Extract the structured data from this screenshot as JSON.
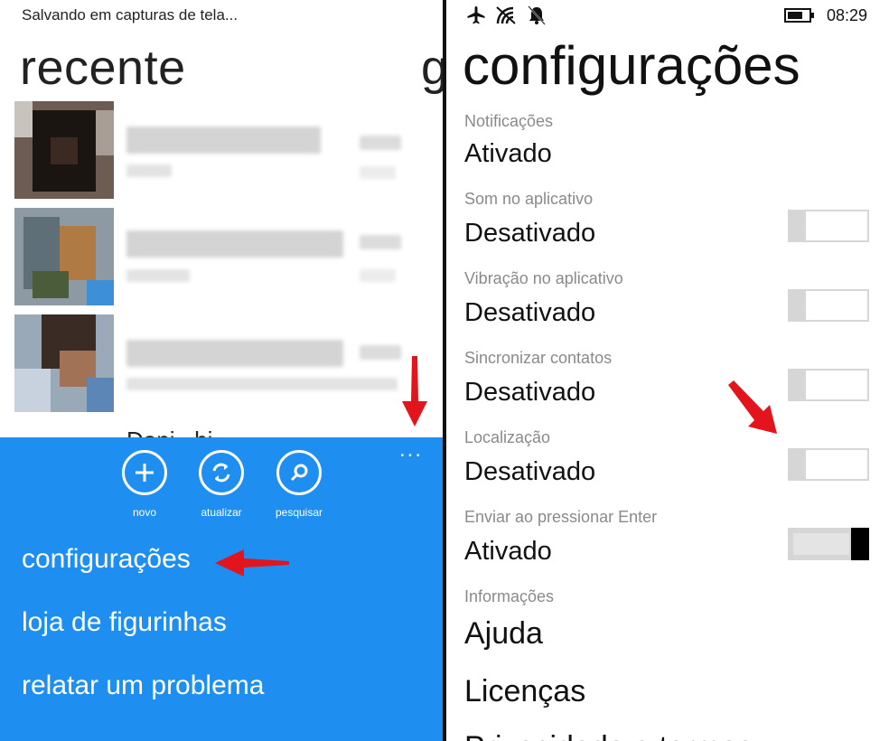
{
  "left": {
    "status_text": "Salvando em capturas de tela...",
    "title": "recente",
    "next_pivot_peek": "g",
    "chats": [
      {
        "name": "contact 1"
      },
      {
        "name": "contact 2"
      },
      {
        "name": "contact 3"
      }
    ],
    "peek_name": "Dani...hi...",
    "appbar": {
      "color": "#1e8ff0",
      "more": "...",
      "buttons": [
        {
          "label": "novo",
          "icon": "plus-icon"
        },
        {
          "label": "atualizar",
          "icon": "refresh-icon"
        },
        {
          "label": "pesquisar",
          "icon": "search-icon"
        }
      ],
      "menu": [
        "configurações",
        "loja de figurinhas",
        "relatar um problema"
      ]
    }
  },
  "right": {
    "clock": "08:29",
    "title": "configurações",
    "settings": [
      {
        "label": "Notificações",
        "value": "Ativado",
        "toggle": null
      },
      {
        "label": "Som no aplicativo",
        "value": "Desativado",
        "toggle": false
      },
      {
        "label": "Vibração no aplicativo",
        "value": "Desativado",
        "toggle": false
      },
      {
        "label": "Sincronizar contatos",
        "value": "Desativado",
        "toggle": false
      },
      {
        "label": "Localização",
        "value": "Desativado",
        "toggle": false
      },
      {
        "label": "Enviar ao pressionar Enter",
        "value": "Ativado",
        "toggle": true
      }
    ],
    "info_label": "Informações",
    "info_links": [
      "Ajuda",
      "Licenças",
      "Privacidade e termos"
    ]
  },
  "annotation_color": "#e3141b"
}
